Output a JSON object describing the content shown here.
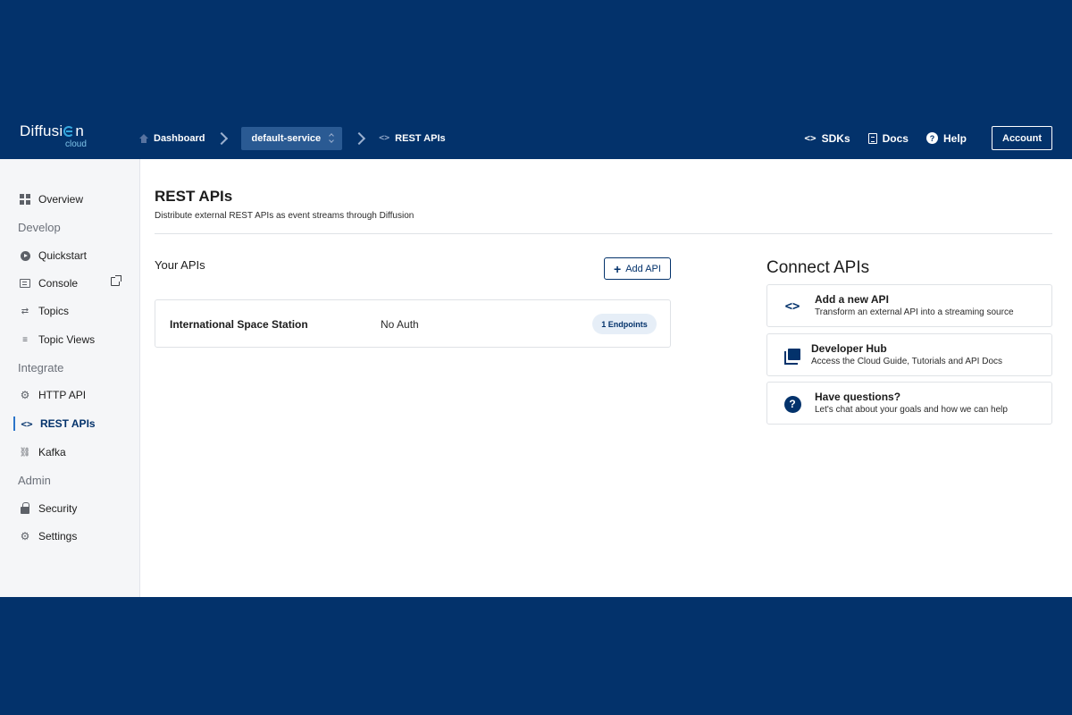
{
  "logo": {
    "main": "Diffusion",
    "main_prefix": "Diffusi",
    "main_suffix": "n",
    "sub": "cloud"
  },
  "breadcrumb": {
    "home": "Dashboard",
    "service": "default-service",
    "current": "REST APIs",
    "current_icon": "<>"
  },
  "topnav": {
    "sdks": "SDKs",
    "sdks_icon": "<>",
    "docs": "Docs",
    "help": "Help",
    "help_icon": "?",
    "account": "Account"
  },
  "sidebar": {
    "overview": "Overview",
    "groups": {
      "develop": "Develop",
      "integrate": "Integrate",
      "admin": "Admin"
    },
    "develop_items": [
      "Quickstart",
      "Console",
      "Topics",
      "Topic Views"
    ],
    "integrate_items": [
      "HTTP API",
      "REST APIs",
      "Kafka"
    ],
    "admin_items": [
      "Security",
      "Settings"
    ],
    "active_item": "REST APIs"
  },
  "main": {
    "title": "REST APIs",
    "subtitle": "Distribute external REST APIs as event streams through Diffusion",
    "your_apis_label": "Your APIs",
    "add_api_label": "Add API",
    "add_api_icon": "+",
    "apis": [
      {
        "name": "International Space Station",
        "auth": "No Auth",
        "endpoints": "1 Endpoints"
      }
    ]
  },
  "connect": {
    "title": "Connect APIs",
    "cards": [
      {
        "title": "Add a new API",
        "desc": "Transform an external API into a streaming source",
        "icon": "code-icon",
        "glyph": "<>"
      },
      {
        "title": "Developer Hub",
        "desc": "Access the Cloud Guide, Tutorials and API Docs",
        "icon": "book-icon"
      },
      {
        "title": "Have questions?",
        "desc": "Let's chat about your goals and how we can help",
        "icon": "question-icon",
        "glyph": "?"
      }
    ]
  },
  "colors": {
    "brand_navy": "#03326b",
    "accent_blue": "#36a9e0",
    "select_bg": "#2a5a93",
    "badge_bg": "#e6eef7"
  }
}
